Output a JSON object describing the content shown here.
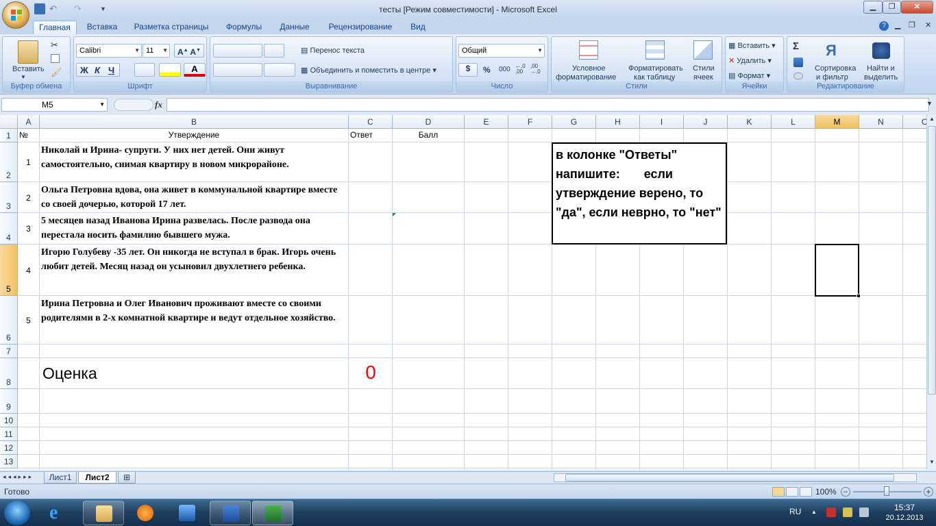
{
  "window": {
    "title": "тесты  [Режим совместимости] - Microsoft Excel"
  },
  "ribbon_tabs": [
    "Главная",
    "Вставка",
    "Разметка страницы",
    "Формулы",
    "Данные",
    "Рецензирование",
    "Вид"
  ],
  "clipboard": {
    "paste": "Вставить",
    "label": "Буфер обмена"
  },
  "font": {
    "name": "Calibri",
    "size": "11",
    "label": "Шрифт",
    "bold": "Ж",
    "italic": "К",
    "underline": "Ч"
  },
  "alignment": {
    "wrap": "Перенос текста",
    "merge": "Объединить и поместить в центре",
    "label": "Выравнивание"
  },
  "number": {
    "format": "Общий",
    "label": "Число",
    "currency": "$",
    "percent": "%",
    "thousands": "000",
    "inc": "←,0 ,00",
    "dec": ",00 →,0"
  },
  "styles": {
    "cond1": "Условное",
    "cond2": "форматирование",
    "table1": "Форматировать",
    "table2": "как таблицу",
    "cell1": "Стили",
    "cell2": "ячеек",
    "label": "Стили"
  },
  "cells": {
    "insert": "Вставить",
    "delete": "Удалить",
    "format": "Формат",
    "label": "Ячейки"
  },
  "editing": {
    "sigma": "Σ",
    "sort1": "Сортировка",
    "sort2": "и фильтр",
    "find1": "Найти и",
    "find2": "выделить",
    "label": "Редактирование"
  },
  "formula_bar": {
    "name_box": "M5",
    "fx": "fx",
    "formula": ""
  },
  "columns": [
    "A",
    "B",
    "C",
    "D",
    "E",
    "F",
    "G",
    "H",
    "I",
    "J",
    "K",
    "L",
    "M",
    "N",
    "O"
  ],
  "rows": [
    "1",
    "2",
    "3",
    "4",
    "5",
    "6",
    "7",
    "8",
    "9",
    "10",
    "11",
    "12",
    "13"
  ],
  "sheet": {
    "header": {
      "num": "№",
      "statement": "Утверждение",
      "answer": "Ответ",
      "score": "Балл"
    },
    "items": [
      {
        "num": "1",
        "text": "Николай и Ирина- супруги. У них нет детей. Они живут самостоятельно, снимая квартиру в новом микрорайоне."
      },
      {
        "num": "2",
        "text": "Ольга Петровна вдова, она живет в коммунальной квартире вместе со своей дочерью, которой 17 лет."
      },
      {
        "num": "3",
        "text": "5 месяцев назад Иванова Ирина развелась. После развода она перестала носить фамилию бывшего мужа."
      },
      {
        "num": "4",
        "text": "Игорю Голубеву -35 лет. Он никогда не вступал в брак. Игорь очень любит детей. Месяц назад он усыновил двухлетнего ребенка."
      },
      {
        "num": "5",
        "text": "Ирина Петровна и Олег Иванович проживают вместе со своими родителями в 2-х комнатной квартире и ведут отдельное хозяйство."
      }
    ],
    "score_label": "Оценка",
    "score_value": "0",
    "note": "в колонке \"Ответы\" напишите:       если утверждение верено, то \"да\", если неврно, то \"нет\""
  },
  "sheet_tabs": [
    "Лист1",
    "Лист2"
  ],
  "status": {
    "ready": "Готово",
    "zoom": "100%"
  },
  "taskbar": {
    "lang": "RU",
    "time": "15:37",
    "date": "20.12.2013"
  },
  "colors": {
    "accent": "#15428b",
    "score_red": "#ff0000",
    "selection_orange": "#f1c15f"
  }
}
